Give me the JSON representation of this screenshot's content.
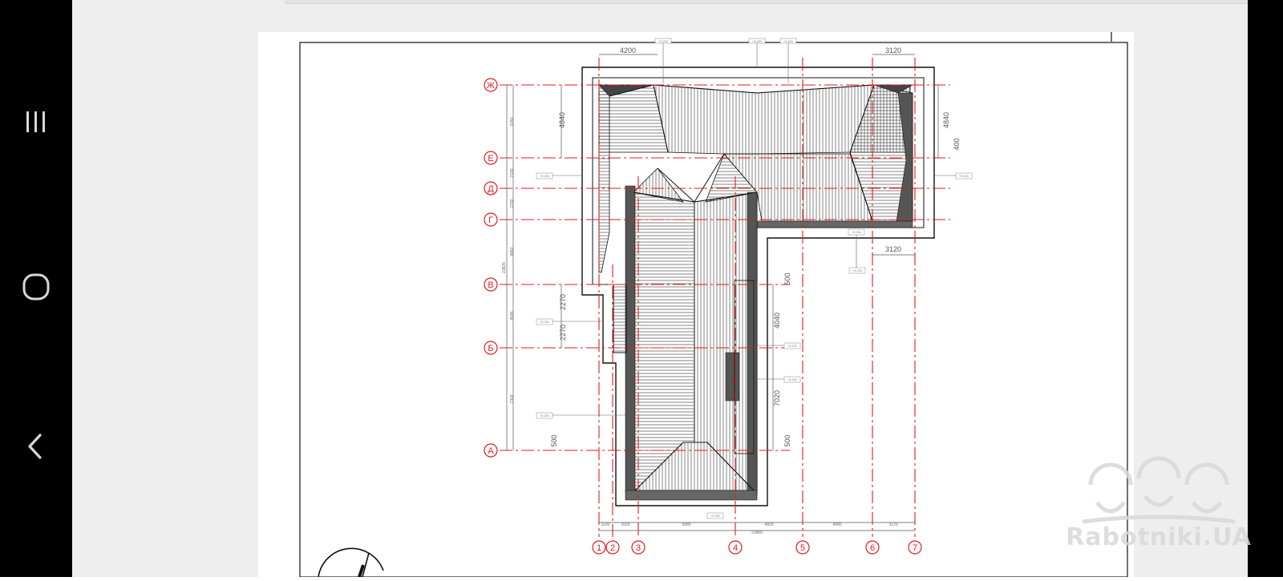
{
  "system_nav": {
    "recents_icon": "recents-icon",
    "home_icon": "home-icon",
    "back_icon": "back-icon"
  },
  "drawing": {
    "axes_letters": [
      "Ж",
      "Е",
      "Д",
      "Г",
      "В",
      "Б",
      "А"
    ],
    "axes_numbers": [
      "1",
      "2",
      "3",
      "4",
      "5",
      "6",
      "7"
    ],
    "dim_top_left": "4200",
    "dim_top_right": "3120",
    "dim_mid_right": "3120",
    "dim_left_4840": "4840",
    "dim_right_4840": "4840",
    "dim_400": "400",
    "dim_2270_a": "2270",
    "dim_2270_b": "2270",
    "dim_500_left": "500",
    "dim_500_right_top": "500",
    "dim_500_right_bottom": "500",
    "dim_4040": "4040",
    "dim_7020": "7020",
    "chain_left": [
      "3240",
      "2190",
      "2230",
      "4860",
      "4545",
      "7303"
    ],
    "chain_left_total": "23825",
    "chain_bottom": [
      "1100",
      "1000",
      "5880",
      "4820",
      "4080",
      "3120"
    ],
    "chain_bottom_total": "22860",
    "level_tags": [
      "+3.201",
      "+3.201",
      "+3.201",
      "+3.201",
      "+3.201",
      "+3.201",
      "+3.201",
      "+3.201",
      "+3.201",
      "+3.201",
      "+3.201",
      "+3.201"
    ]
  },
  "watermark": {
    "text": "Rabotniki.UA",
    "logo_icon": "builders-helmets-icon"
  },
  "colors": {
    "axis_red": "#e21b1b",
    "line_black": "#111111",
    "system_bar": "#000000",
    "viewer_bg": "#eeeeee"
  }
}
